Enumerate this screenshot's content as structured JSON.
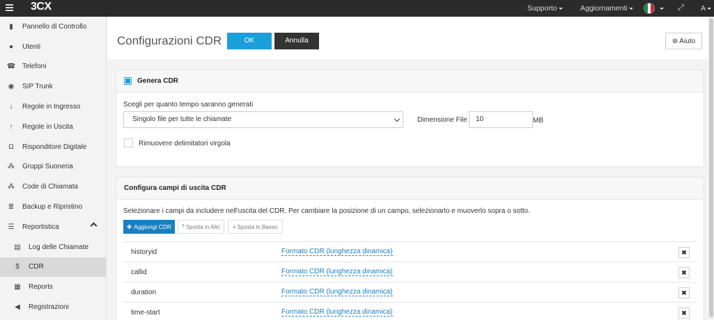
{
  "app": {
    "logo": "3CX"
  },
  "topbar": {
    "support_label": "Supporto",
    "updates_label": "Aggiornamenti",
    "user_initial": "A",
    "flag_colors": [
      "#009246",
      "#ffffff",
      "#ce2b37"
    ]
  },
  "sidebar": {
    "items": [
      {
        "label": "Pannello di Controllo",
        "icon": "bar-chart-icon"
      },
      {
        "label": "Utenti",
        "icon": "user-icon"
      },
      {
        "label": "Telefoni",
        "icon": "phone-icon"
      },
      {
        "label": "SIP Trunk",
        "icon": "globe-icon"
      },
      {
        "label": "Regole in Ingresso",
        "icon": "arrow-down-icon"
      },
      {
        "label": "Regole in Uscita",
        "icon": "arrow-up-icon"
      },
      {
        "label": "Risponditore Digitale",
        "icon": "headset-icon"
      },
      {
        "label": "Gruppi Suoneria",
        "icon": "group-icon"
      },
      {
        "label": "Code di Chiamata",
        "icon": "queue-icon"
      },
      {
        "label": "Backup e Ripristino",
        "icon": "database-icon"
      },
      {
        "label": "Reportistica",
        "icon": "list-icon"
      },
      {
        "label": "Log delle Chiamate",
        "icon": "document-icon"
      },
      {
        "label": "CDR",
        "icon": "dollar-icon"
      },
      {
        "label": "Reports",
        "icon": "report-icon"
      },
      {
        "label": "Registrazioni",
        "icon": "volume-icon"
      }
    ]
  },
  "header": {
    "title": "Configurazioni CDR",
    "ok_label": "OK",
    "cancel_label": "Annulla",
    "help_label": "Aiuto"
  },
  "generate_panel": {
    "title": "Genera CDR",
    "checked": true,
    "duration_label": "Scegli per quanto tempo saranno generati",
    "duration_value": "Singolo file per tutte le chiamate",
    "file_size_label": "Dimensione File",
    "file_size_value": "10",
    "file_size_unit": "MB",
    "remove_delimiters_label": "Rimuovere delimitatori virgola",
    "remove_delimiters_checked": false
  },
  "fields_panel": {
    "title": "Configura campi di uscita CDR",
    "description": "Selezionare i campi da includere nell'uscita del CDR. Per cambiare la posizione di un campo, selezionarlo e muoverlo sopra o sotto.",
    "add_label": "Aggiungi CDR",
    "move_up_label": "Sposta in Alto",
    "move_down_label": "Sposta in Basso",
    "rows": [
      {
        "name": "historyid",
        "format": "Formato CDR (lunghezza dinamica)"
      },
      {
        "name": "callid",
        "format": "Formato CDR (lunghezza dinamica)"
      },
      {
        "name": "duration",
        "format": "Formato CDR (lunghezza dinamica)"
      },
      {
        "name": "time-start",
        "format": "Formato CDR (lunghezza dinamica)"
      }
    ]
  }
}
